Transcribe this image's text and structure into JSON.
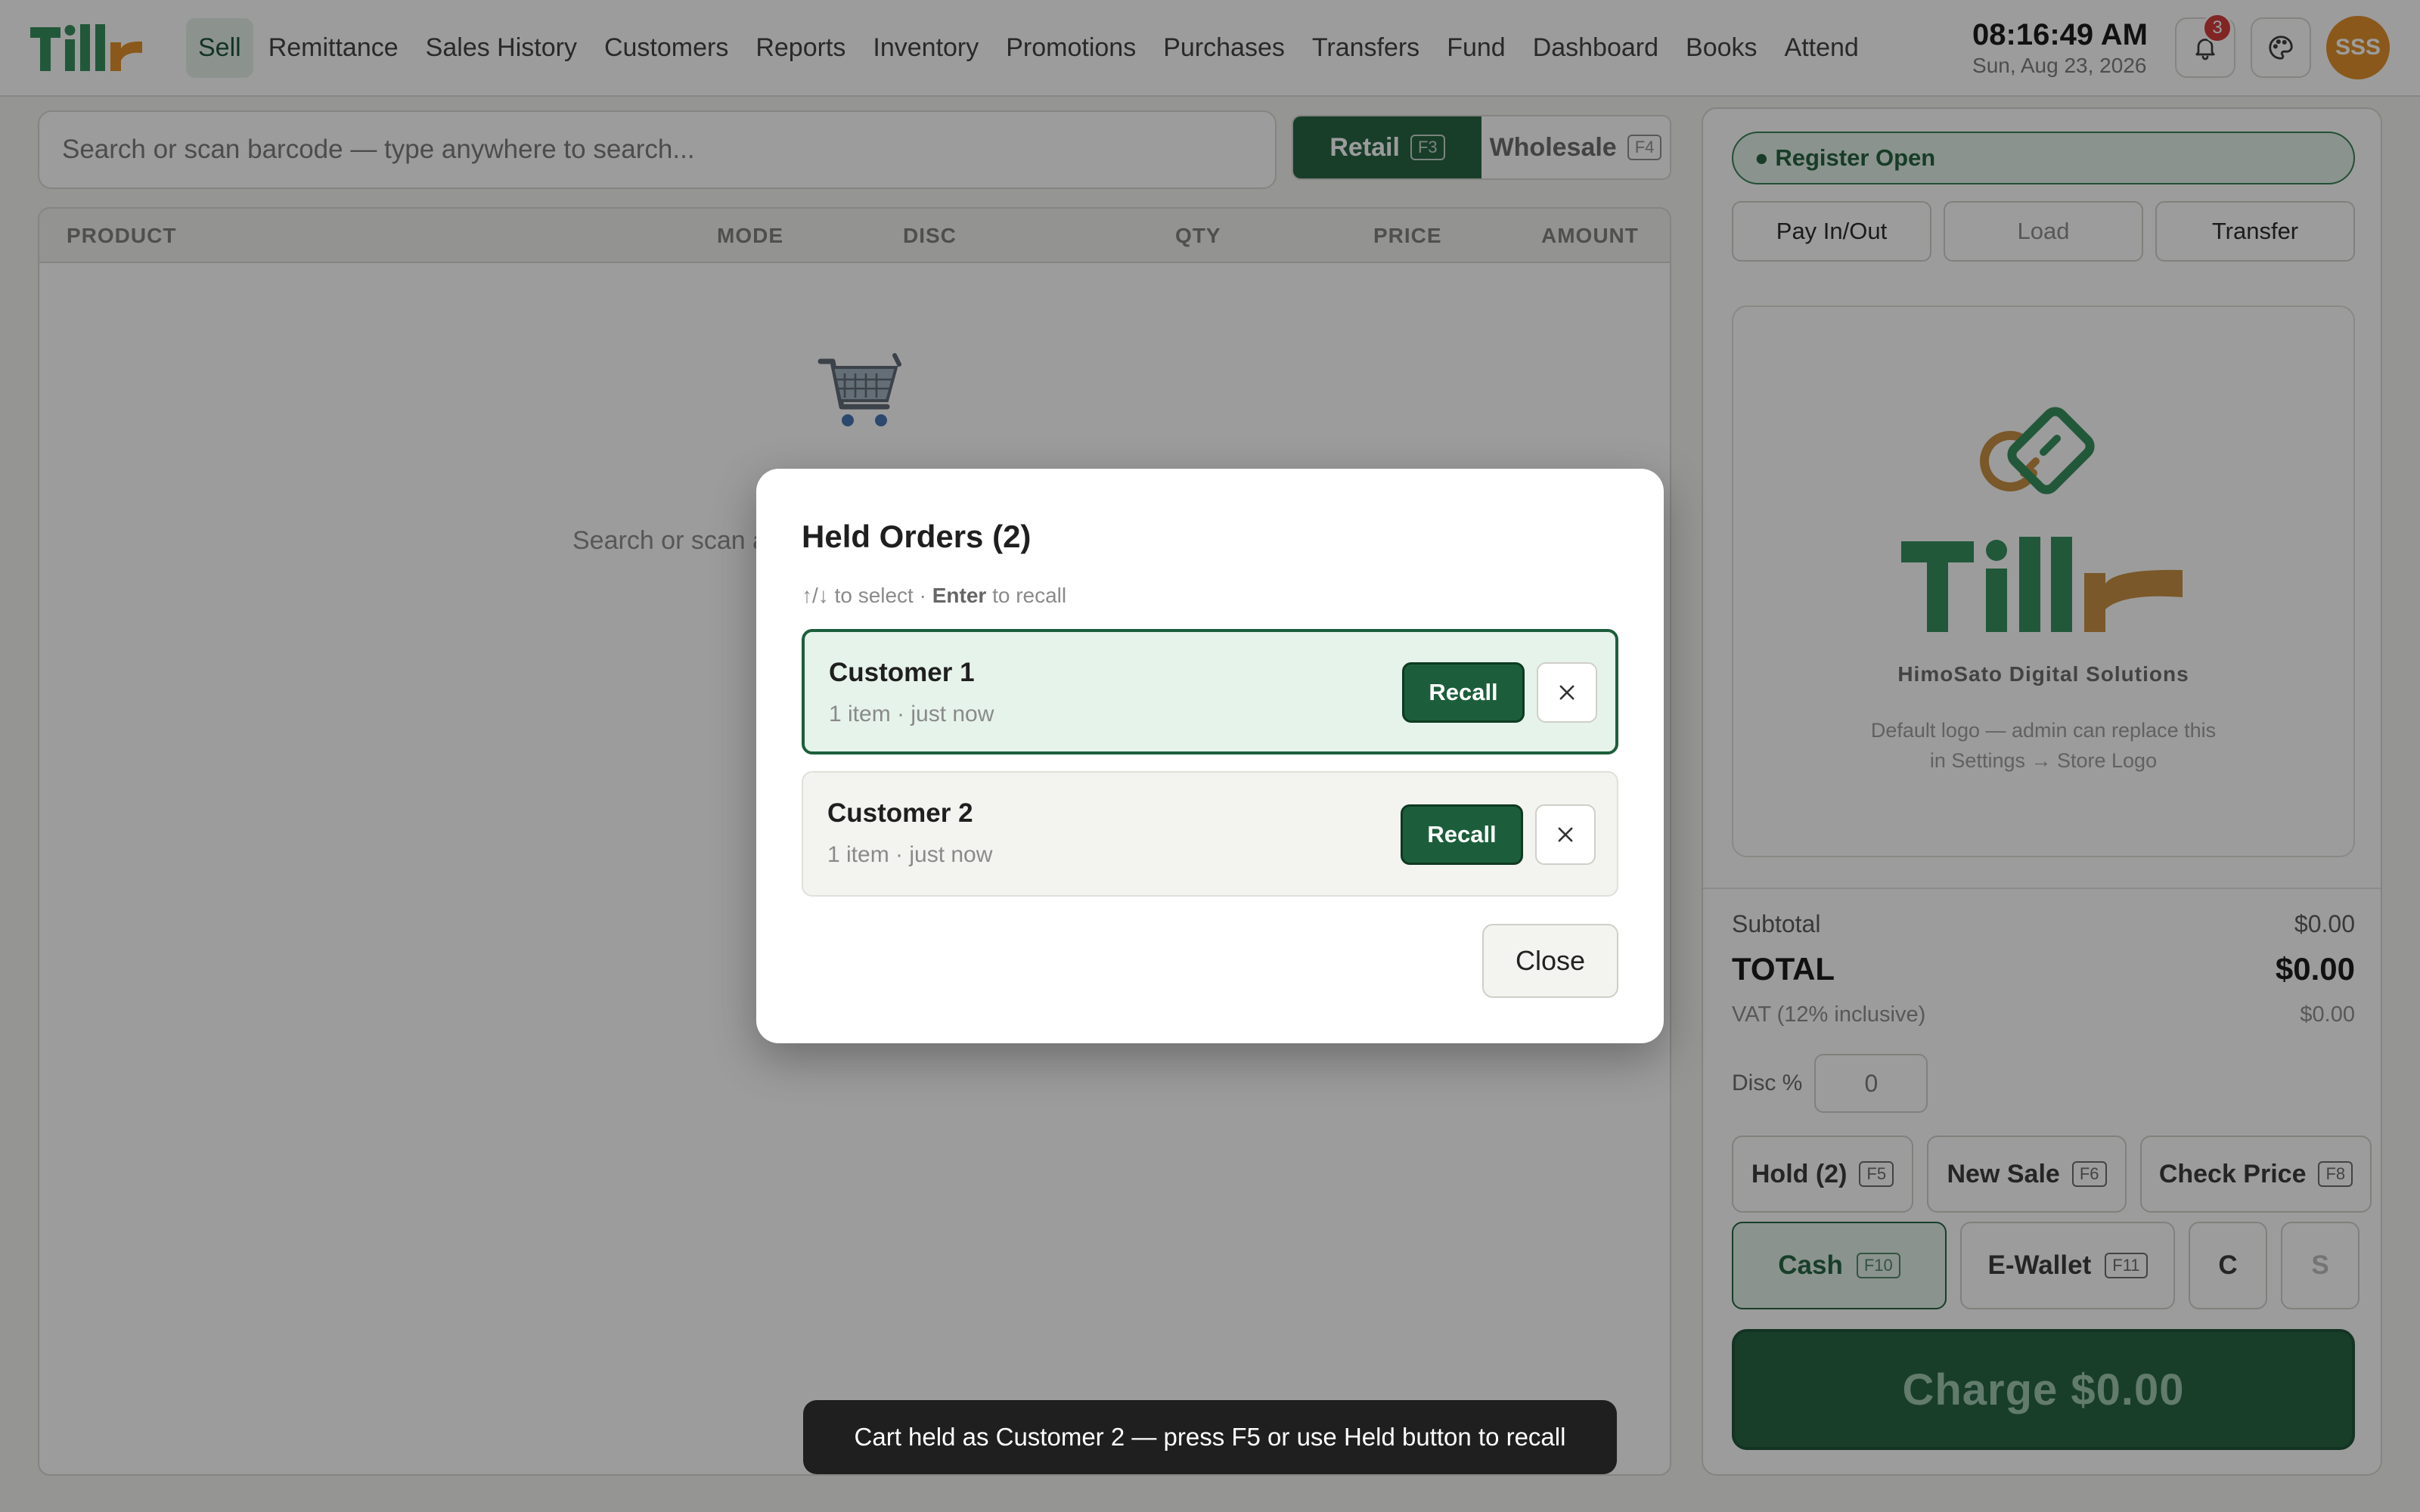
{
  "brand": {
    "logo_text": "Tillr",
    "accent": "#1c5e3b",
    "logo_orange": "#e08a1f",
    "logo_green": "#2e8b57"
  },
  "nav": {
    "items": [
      "Sell",
      "Remittance",
      "Sales History",
      "Customers",
      "Reports",
      "Inventory",
      "Promotions",
      "Purchases",
      "Transfers",
      "Fund",
      "Dashboard",
      "Books",
      "Attend"
    ],
    "active": "Sell"
  },
  "header": {
    "time": "08:16:49 AM",
    "date": "Sun, Aug 23, 2026",
    "notifications_count": "3",
    "avatar_initials": "SSS",
    "icons": [
      "bell-icon",
      "palette-icon"
    ]
  },
  "search": {
    "placeholder": "Search or scan barcode — type anywhere to search..."
  },
  "mode": {
    "retail_label": "Retail",
    "retail_key": "F3",
    "wholesale_label": "Wholesale",
    "wholesale_key": "F4",
    "active": "Retail"
  },
  "cart": {
    "columns": {
      "product": "PRODUCT",
      "mode": "MODE",
      "disc": "DISC",
      "qty": "QTY",
      "price": "PRICE",
      "amount": "AMOUNT"
    },
    "empty_text": "Search or scan a"
  },
  "register": {
    "status": "● Register Open",
    "buttons": [
      "Pay In/Out",
      "Load",
      "Transfer"
    ]
  },
  "store_logo": {
    "company": "HimoSato Digital Solutions",
    "hint_line1": "Default logo — admin can replace this",
    "hint_line2": "in Settings → Store Logo"
  },
  "summary": {
    "subtotal_label": "Subtotal",
    "subtotal_value": "$0.00",
    "total_label": "TOTAL",
    "total_value": "$0.00",
    "vat_label": "VAT (12% inclusive)",
    "vat_value": "$0.00",
    "disc_label": "Disc %",
    "disc_value": "0"
  },
  "actions": {
    "hold_label": "Hold (2)",
    "hold_key": "F5",
    "new_sale_label": "New Sale",
    "new_sale_key": "F6",
    "check_price_label": "Check Price",
    "check_price_key": "F8"
  },
  "payment": {
    "cash_label": "Cash",
    "cash_key": "F10",
    "ewallet_label": "E-Wallet",
    "ewallet_key": "F11",
    "c_label": "C",
    "s_label": "S",
    "active": "Cash"
  },
  "charge_label": "Charge $0.00",
  "modal": {
    "title": "Held Orders (2)",
    "hint_prefix": "↑/↓ to select · ",
    "hint_bold": "Enter",
    "hint_suffix": " to recall",
    "orders": [
      {
        "name": "Customer 1",
        "meta": "1 item · just now",
        "recall": "Recall",
        "selected": true
      },
      {
        "name": "Customer 2",
        "meta": "1 item · just now",
        "recall": "Recall",
        "selected": false
      }
    ],
    "close_label": "Close"
  },
  "toast": "Cart held as Customer 2 — press F5 or use Held button to recall"
}
